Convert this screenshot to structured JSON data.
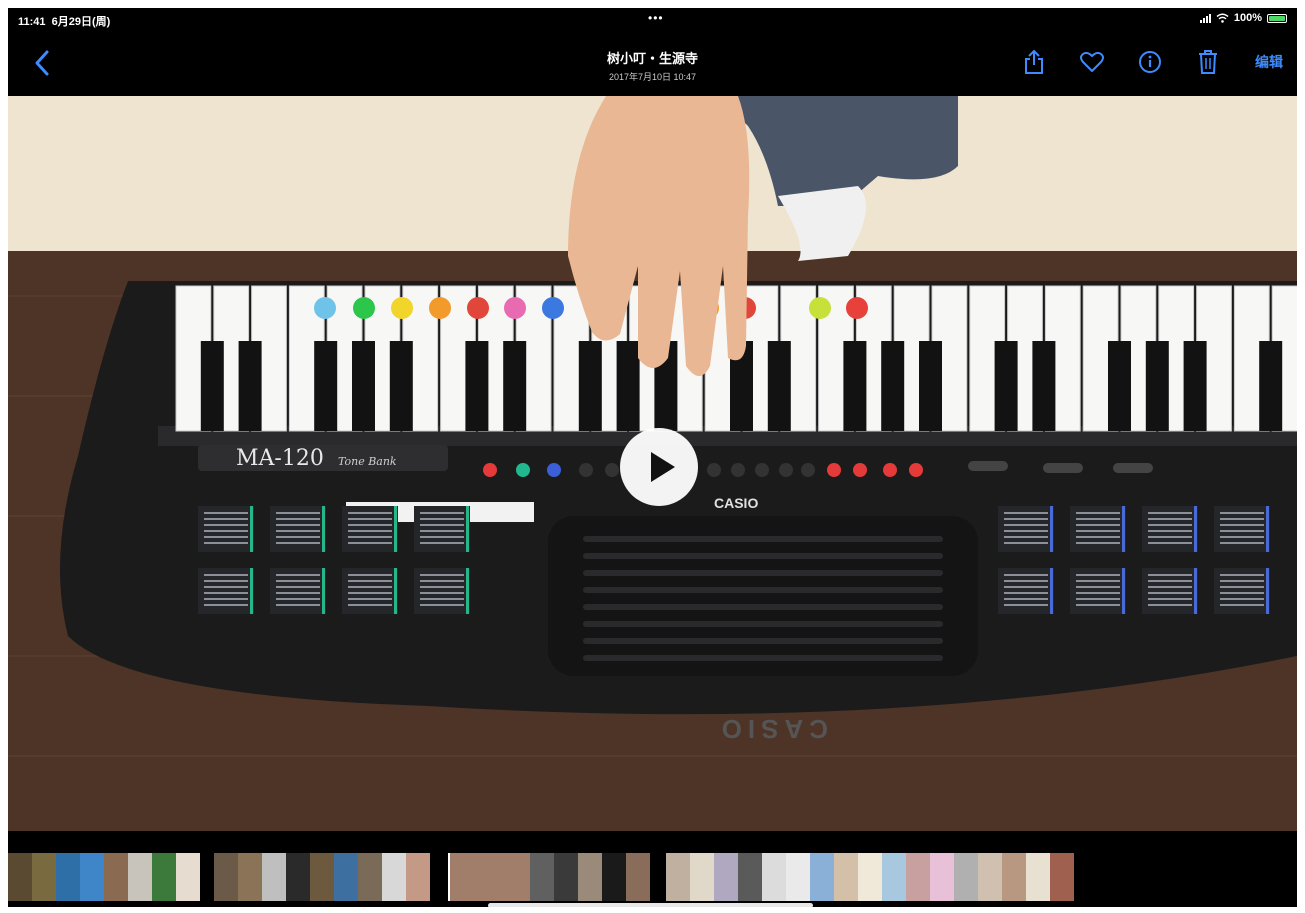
{
  "status": {
    "time": "11:41",
    "date": "6月29日(周)",
    "dots": "•••",
    "battery": "100%"
  },
  "nav": {
    "title": "树小叮・生源寺",
    "subtitle": "2017年7月10日 10:47",
    "edit_label": "编辑"
  },
  "photo": {
    "keyboard_model": "MA-120",
    "keyboard_series": "Tone Bank",
    "keyboard_brand": "CASIO",
    "play_icon": "play-icon"
  },
  "filmstrip": {
    "colors": [
      "#5a4a32",
      "#7a6a40",
      "#2e6fa8",
      "#3f86c9",
      "#8b6a52",
      "#c8c4bc",
      "#3c7a3c",
      "#e6ddd0",
      "#6b5a48",
      "#8a7356",
      "#bfbfbf",
      "#2a2a2a",
      "#6d5a3e",
      "#3d6fa0",
      "#7a6a58",
      "#d8d8d8",
      "#c49a86",
      "#a07e6a",
      "#606060",
      "#3a3a3a",
      "#9a8a7a",
      "#1a1a1a",
      "#8a6c5a",
      "#c0b0a0",
      "#e0d8c8",
      "#b0a8c0",
      "#5a5a5a",
      "#dcdcdc",
      "#eaeaea",
      "#8ab0d8",
      "#d4c0a8",
      "#f0e8d8",
      "#a8c8e0",
      "#c8a0a0",
      "#e8c0d8",
      "#b0b0b0",
      "#d0c0b0",
      "#b89880",
      "#e8e0d0",
      "#a06050"
    ]
  }
}
